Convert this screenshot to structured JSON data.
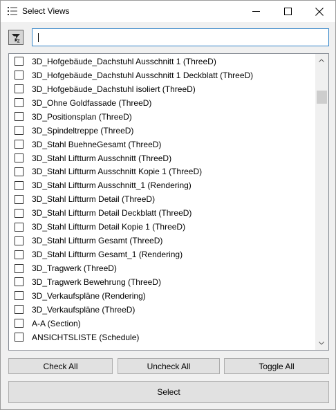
{
  "window": {
    "title": "Select Views",
    "icon": "list-icon",
    "controls": [
      "minimize-icon",
      "maximize-icon",
      "close-icon"
    ]
  },
  "toolbar": {
    "sort_button_icon": "sort-az-icon",
    "search_value": "",
    "search_placeholder": ""
  },
  "views_list": {
    "items": [
      {
        "label": "3D_Hofgebäude_Dachstuhl Ausschnitt 1 (ThreeD)",
        "checked": false
      },
      {
        "label": "3D_Hofgebäude_Dachstuhl Ausschnitt 1 Deckblatt (ThreeD)",
        "checked": false
      },
      {
        "label": "3D_Hofgebäude_Dachstuhl isoliert (ThreeD)",
        "checked": false
      },
      {
        "label": "3D_Ohne Goldfassade (ThreeD)",
        "checked": false
      },
      {
        "label": "3D_Positionsplan (ThreeD)",
        "checked": false
      },
      {
        "label": "3D_Spindeltreppe (ThreeD)",
        "checked": false
      },
      {
        "label": "3D_Stahl BuehneGesamt (ThreeD)",
        "checked": false
      },
      {
        "label": "3D_Stahl Liftturm Ausschnitt (ThreeD)",
        "checked": false
      },
      {
        "label": "3D_Stahl Liftturm Ausschnitt Kopie 1 (ThreeD)",
        "checked": false
      },
      {
        "label": "3D_Stahl Liftturm Ausschnitt_1 (Rendering)",
        "checked": false
      },
      {
        "label": "3D_Stahl Liftturm Detail (ThreeD)",
        "checked": false
      },
      {
        "label": "3D_Stahl Liftturm Detail Deckblatt (ThreeD)",
        "checked": false
      },
      {
        "label": "3D_Stahl Liftturm Detail Kopie 1 (ThreeD)",
        "checked": false
      },
      {
        "label": "3D_Stahl Liftturm Gesamt (ThreeD)",
        "checked": false
      },
      {
        "label": "3D_Stahl Liftturm Gesamt_1 (Rendering)",
        "checked": false
      },
      {
        "label": "3D_Tragwerk (ThreeD)",
        "checked": false
      },
      {
        "label": "3D_Tragwerk Bewehrung (ThreeD)",
        "checked": false
      },
      {
        "label": "3D_Verkaufspläne (Rendering)",
        "checked": false
      },
      {
        "label": "3D_Verkaufspläne (ThreeD)",
        "checked": false
      },
      {
        "label": "A-A (Section)",
        "checked": false
      },
      {
        "label": "ANSICHTSLISTE (Schedule)",
        "checked": false
      }
    ]
  },
  "actions": {
    "check_all": "Check All",
    "uncheck_all": "Uncheck All",
    "toggle_all": "Toggle All",
    "select": "Select"
  }
}
